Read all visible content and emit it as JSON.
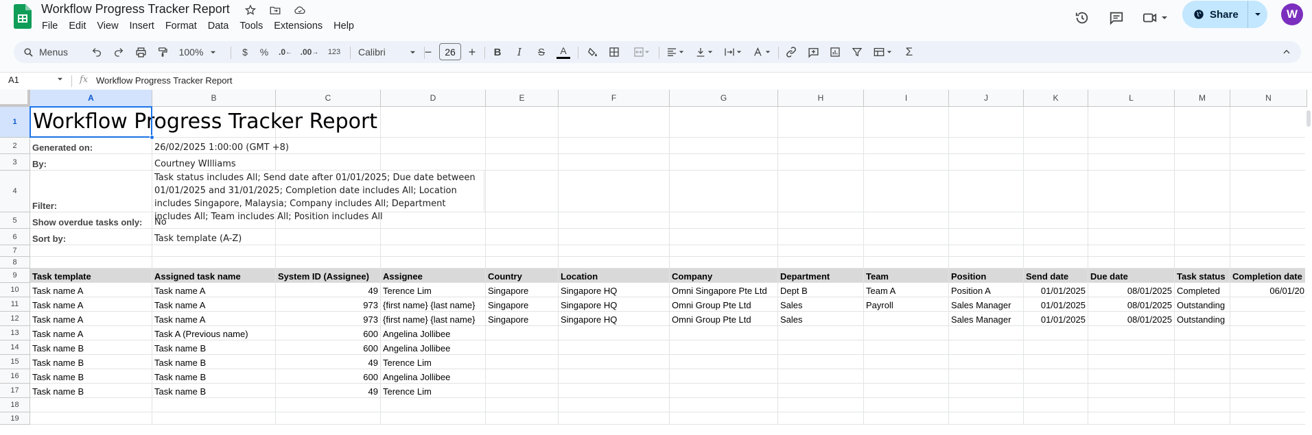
{
  "app": {
    "doc_title": "Workflow Progress Tracker Report",
    "menu": [
      "File",
      "Edit",
      "View",
      "Insert",
      "Format",
      "Data",
      "Tools",
      "Extensions",
      "Help"
    ],
    "share_label": "Share",
    "avatar_initial": "W"
  },
  "toolbar": {
    "menus_label": "Menus",
    "zoom": "100%",
    "currency": "$",
    "percent": "%",
    "dec_decrease": ".0",
    "dec_increase": ".00",
    "number_format": "123",
    "font": "Calibri",
    "font_size": "26"
  },
  "formula_bar": {
    "cell_ref": "A1",
    "fx": "fx",
    "content": "Workflow Progress Tracker Report"
  },
  "grid": {
    "columns": [
      "A",
      "B",
      "C",
      "D",
      "E",
      "F",
      "G",
      "H",
      "I",
      "J",
      "K",
      "L",
      "M",
      "N"
    ],
    "rows": [
      "1",
      "2",
      "3",
      "4",
      "5",
      "6",
      "7",
      "8",
      "9",
      "10",
      "11",
      "12",
      "13",
      "14",
      "15",
      "16",
      "17",
      "18",
      "19"
    ],
    "report_title": "Workflow Progress Tracker Report",
    "meta": [
      {
        "label": "Generated on:",
        "value": "26/02/2025 1:00:00 (GMT +8)"
      },
      {
        "label": "By:",
        "value": "Courtney WIlliams"
      },
      {
        "label": "Filter:",
        "value": "Task status includes All; Send date after 01/01/2025; Due date between 01/01/2025 and 31/01/2025; Completion date includes All; Location includes Singapore, Malaysia; Company includes All; Department includes All; Team includes All; Position includes All"
      },
      {
        "label": "Show overdue tasks only:",
        "value": "No"
      },
      {
        "label": "Sort by:",
        "value": "Task template (A-Z)"
      }
    ],
    "headers": [
      "Task template",
      "Assigned task name",
      "System ID (Assignee)",
      "Assignee",
      "Country",
      "Location",
      "Company",
      "Department",
      "Team",
      "Position",
      "Send date",
      "Due date",
      "Task status",
      "Completion date"
    ],
    "data_rows": [
      [
        "Task name A",
        "Task name A",
        "49",
        "Terence Lim",
        "Singapore",
        "Singapore HQ",
        "Omni Singapore Pte Ltd",
        "Dept B",
        "Team A",
        "Position A",
        "01/01/2025",
        "08/01/2025",
        "Completed",
        "06/01/20"
      ],
      [
        "Task name A",
        "Task name A",
        "973",
        "{first name} {last name}",
        "Singapore",
        "Singapore HQ",
        "Omni Group Pte Ltd",
        "Sales",
        "Payroll",
        "Sales Manager",
        "01/01/2025",
        "08/01/2025",
        "Outstanding",
        ""
      ],
      [
        "Task name A",
        "Task name A",
        "973",
        "{first name} {last name}",
        "Singapore",
        "Singapore HQ",
        "Omni Group Pte Ltd",
        "Sales",
        "",
        "Sales Manager",
        "01/01/2025",
        "08/01/2025",
        "Outstanding",
        ""
      ],
      [
        "Task name A",
        "Task A (Previous name)",
        "600",
        "Angelina Jollibee",
        "",
        "",
        "",
        "",
        "",
        "",
        "",
        "",
        "",
        ""
      ],
      [
        "Task name B",
        "Task name B",
        "600",
        "Angelina Jollibee",
        "",
        "",
        "",
        "",
        "",
        "",
        "",
        "",
        "",
        ""
      ],
      [
        "Task name B",
        "Task name B",
        "49",
        "Terence Lim",
        "",
        "",
        "",
        "",
        "",
        "",
        "",
        "",
        "",
        ""
      ],
      [
        "Task name B",
        "Task name B",
        "600",
        "Angelina Jollibee",
        "",
        "",
        "",
        "",
        "",
        "",
        "",
        "",
        "",
        ""
      ],
      [
        "Task name B",
        "Task name B",
        "49",
        "Terence Lim",
        "",
        "",
        "",
        "",
        "",
        "",
        "",
        "",
        "",
        ""
      ]
    ]
  }
}
